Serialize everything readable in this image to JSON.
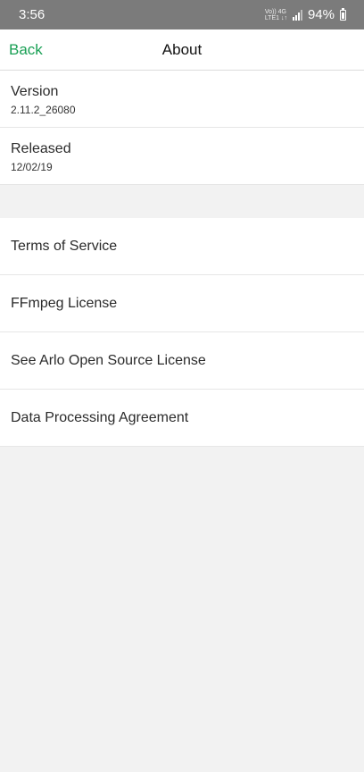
{
  "status_bar": {
    "time": "3:56",
    "network_top": "Vo)) 4G",
    "network_bottom": "LTE1 ↓↑",
    "battery": "94%"
  },
  "header": {
    "back_label": "Back",
    "title": "About",
    "accent_color": "#1aa055"
  },
  "info": {
    "version_label": "Version",
    "version_value": "2.11.2_26080",
    "released_label": "Released",
    "released_value": "12/02/19"
  },
  "links": [
    {
      "label": "Terms of Service"
    },
    {
      "label": "FFmpeg License"
    },
    {
      "label": "See Arlo Open Source License"
    },
    {
      "label": "Data Processing Agreement"
    }
  ]
}
